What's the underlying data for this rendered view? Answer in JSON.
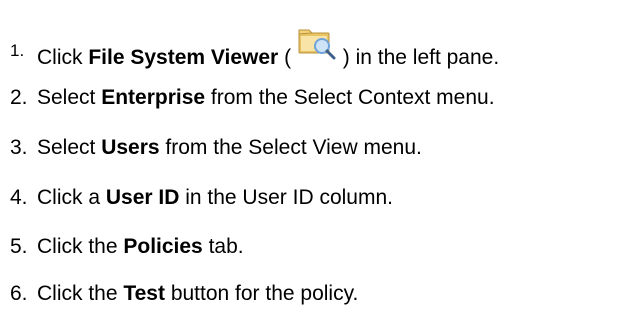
{
  "steps": [
    {
      "number": "1.",
      "pre": "Click ",
      "bold": "File System Viewer",
      "mid": " ( ",
      "icon": "folder-magnifier-icon",
      "post": " ) in the left pane."
    },
    {
      "number": "2.",
      "pre": "Select ",
      "bold": "Enterprise",
      "post": " from the Select Context menu."
    },
    {
      "number": "3.",
      "pre": "Select ",
      "bold": "Users",
      "post": " from the Select View menu."
    },
    {
      "number": "4.",
      "pre": "Click a ",
      "bold": "User ID",
      "post": " in the User ID column."
    },
    {
      "number": "5.",
      "pre": "Click the ",
      "bold": "Policies",
      "post": " tab."
    },
    {
      "number": "6.",
      "pre": "Click the ",
      "bold": "Test",
      "post": " button for the policy."
    }
  ],
  "colors": {
    "text": "#000000",
    "folder": "#f2d17a",
    "magnifier_lens": "#6fa3d9"
  }
}
